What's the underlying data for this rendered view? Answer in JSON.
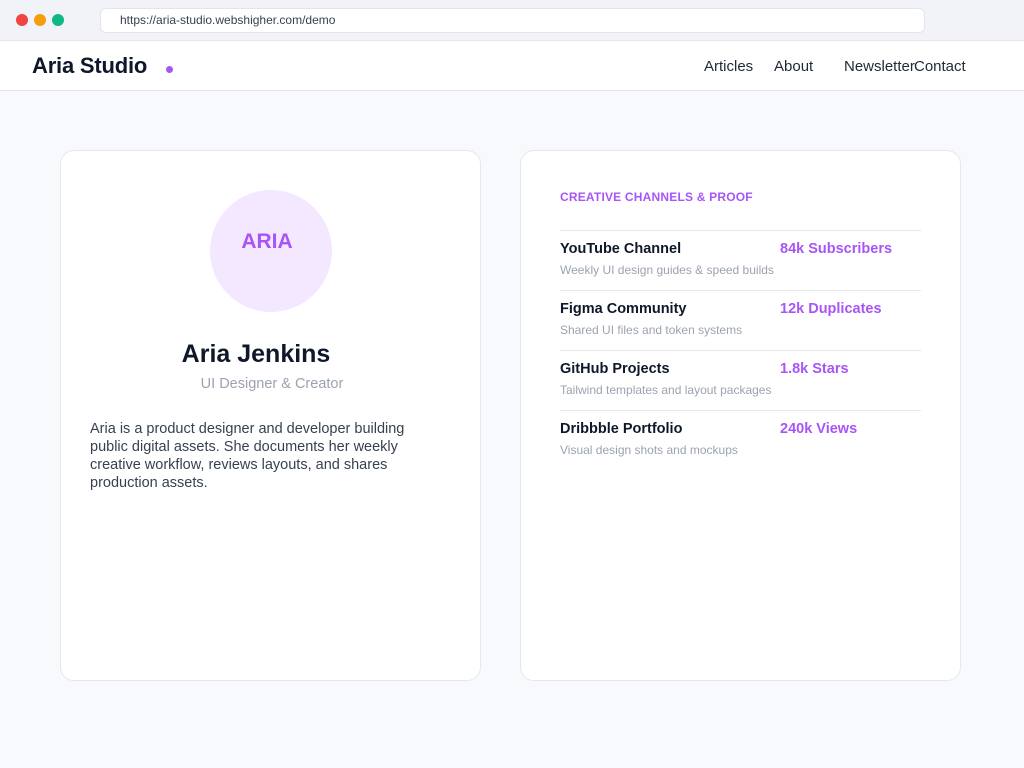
{
  "browser": {
    "url": "https://aria-studio.webshigher.com/demo"
  },
  "header": {
    "brand": "Aria Studio",
    "nav": [
      {
        "label": "Articles"
      },
      {
        "label": "About"
      },
      {
        "label": "Newsletter"
      },
      {
        "label": "Contact"
      }
    ]
  },
  "profile": {
    "avatar_text": "ARIA",
    "name": "Aria Jenkins",
    "role": "UI Designer & Creator",
    "bio": "Aria is a product designer and developer building public digital assets. She documents her weekly creative workflow, reviews layouts, and shares production assets."
  },
  "channels": {
    "title": "CREATIVE CHANNELS & PROOF",
    "items": [
      {
        "name": "YouTube Channel",
        "metric": "84k Subscribers",
        "desc": "Weekly UI design guides & speed builds"
      },
      {
        "name": "Figma Community",
        "metric": "12k Duplicates",
        "desc": "Shared UI files and token systems"
      },
      {
        "name": "GitHub Projects",
        "metric": "1.8k Stars",
        "desc": "Tailwind templates and layout packages"
      },
      {
        "name": "Dribbble Portfolio",
        "metric": "240k Views",
        "desc": "Visual design shots and mockups"
      }
    ]
  },
  "colors": {
    "accent": "#a855f7",
    "avatar_bg": "#f3e8ff",
    "page_bg": "#f8f9fc"
  }
}
